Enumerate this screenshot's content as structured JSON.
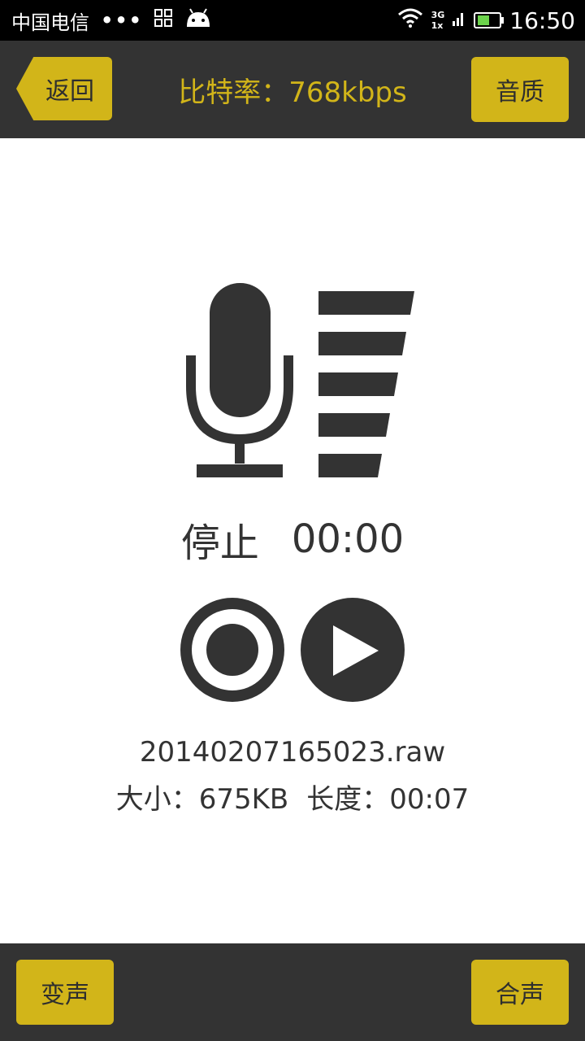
{
  "status_bar": {
    "carrier": "中国电信",
    "dots": "•••",
    "net_top": "3G",
    "net_bottom": "1x",
    "time": "16:50"
  },
  "header": {
    "back_label": "返回",
    "title": "比特率：768kbps",
    "quality_label": "音质"
  },
  "recorder": {
    "state": "停止",
    "elapsed": "00:00"
  },
  "file": {
    "name": "20140207165023.raw",
    "size_text": "大小：675KB",
    "length_text": "长度：00:07"
  },
  "footer": {
    "voice_change_label": "变声",
    "mix_label": "合声"
  },
  "colors": {
    "accent": "#d2b519",
    "bar": "#333333",
    "icon": "#333333"
  }
}
